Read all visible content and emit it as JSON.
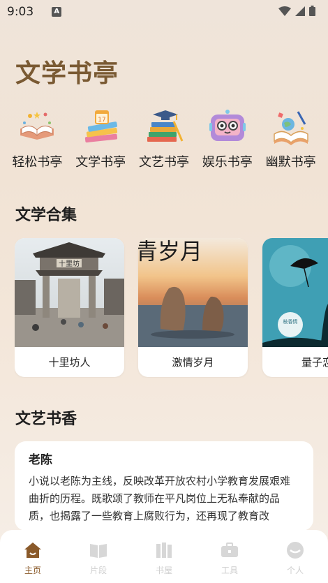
{
  "status_bar": {
    "time": "9:03",
    "notification_icon": "A"
  },
  "app_title": "文学书亭",
  "categories": [
    {
      "label": "轻松书亭",
      "icon": "open-book-sparkles-icon"
    },
    {
      "label": "文学书亭",
      "icon": "book-stack-calendar-icon"
    },
    {
      "label": "文艺书亭",
      "icon": "books-graduation-cap-icon"
    },
    {
      "label": "娱乐书亭",
      "icon": "robot-tv-icon"
    },
    {
      "label": "幽默书亭",
      "icon": "book-globe-pen-icon"
    }
  ],
  "sections": {
    "collection_title": "文学合集",
    "fragrance_title": "文艺书香"
  },
  "collection": [
    {
      "label": "十里坊人",
      "image_text": "十里坊"
    },
    {
      "label": "激情岁月",
      "image_text": "青岁月"
    },
    {
      "label": "量子恋",
      "image_text": "枝香情"
    }
  ],
  "article": {
    "title": "老陈",
    "body": "小说以老陈为主线，反映改革开放农村小学教育发展艰难曲折的历程。既歌颂了教师在平凡岗位上无私奉献的品质，也揭露了一些教育上腐败行为，还再现了教育改"
  },
  "tabs": [
    {
      "label": "主页",
      "icon": "home-icon",
      "active": true
    },
    {
      "label": "片段",
      "icon": "book-open-icon",
      "active": false
    },
    {
      "label": "书屋",
      "icon": "bookshelf-icon",
      "active": false
    },
    {
      "label": "工具",
      "icon": "toolbox-icon",
      "active": false
    },
    {
      "label": "个人",
      "icon": "user-icon",
      "active": false
    }
  ],
  "colors": {
    "brand": "#7a5a33",
    "active_tab": "#8a5a2a",
    "inactive_tab": "#cfcfcf"
  }
}
